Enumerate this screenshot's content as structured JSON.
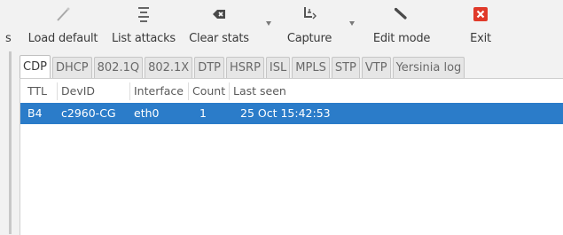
{
  "toolbar": {
    "cut_label": "s",
    "load_default": "Load default",
    "list_attacks": "List attacks",
    "clear_stats": "Clear stats",
    "capture": "Capture",
    "edit_mode": "Edit mode",
    "exit": "Exit",
    "icons": {
      "load_default": "wand-icon",
      "list_attacks": "list-icon",
      "clear_stats": "clear-icon",
      "capture": "capture-icon",
      "edit_mode": "edit-wand-icon",
      "exit": "exit-icon"
    },
    "exit_color": "#e03a2a"
  },
  "tabs": [
    "CDP",
    "DHCP",
    "802.1Q",
    "802.1X",
    "DTP",
    "HSRP",
    "ISL",
    "MPLS",
    "STP",
    "VTP",
    "Yersinia log"
  ],
  "active_tab": "CDP",
  "table": {
    "columns": [
      "TTL",
      "DevID",
      "Interface",
      "Count",
      "Last seen"
    ],
    "rows": [
      {
        "ttl": "B4",
        "devid": "c2960-CG",
        "interface": "eth0",
        "count": "1",
        "last_seen": "25 Oct 15:42:53"
      }
    ],
    "selection_color": "#2b7cc9"
  }
}
